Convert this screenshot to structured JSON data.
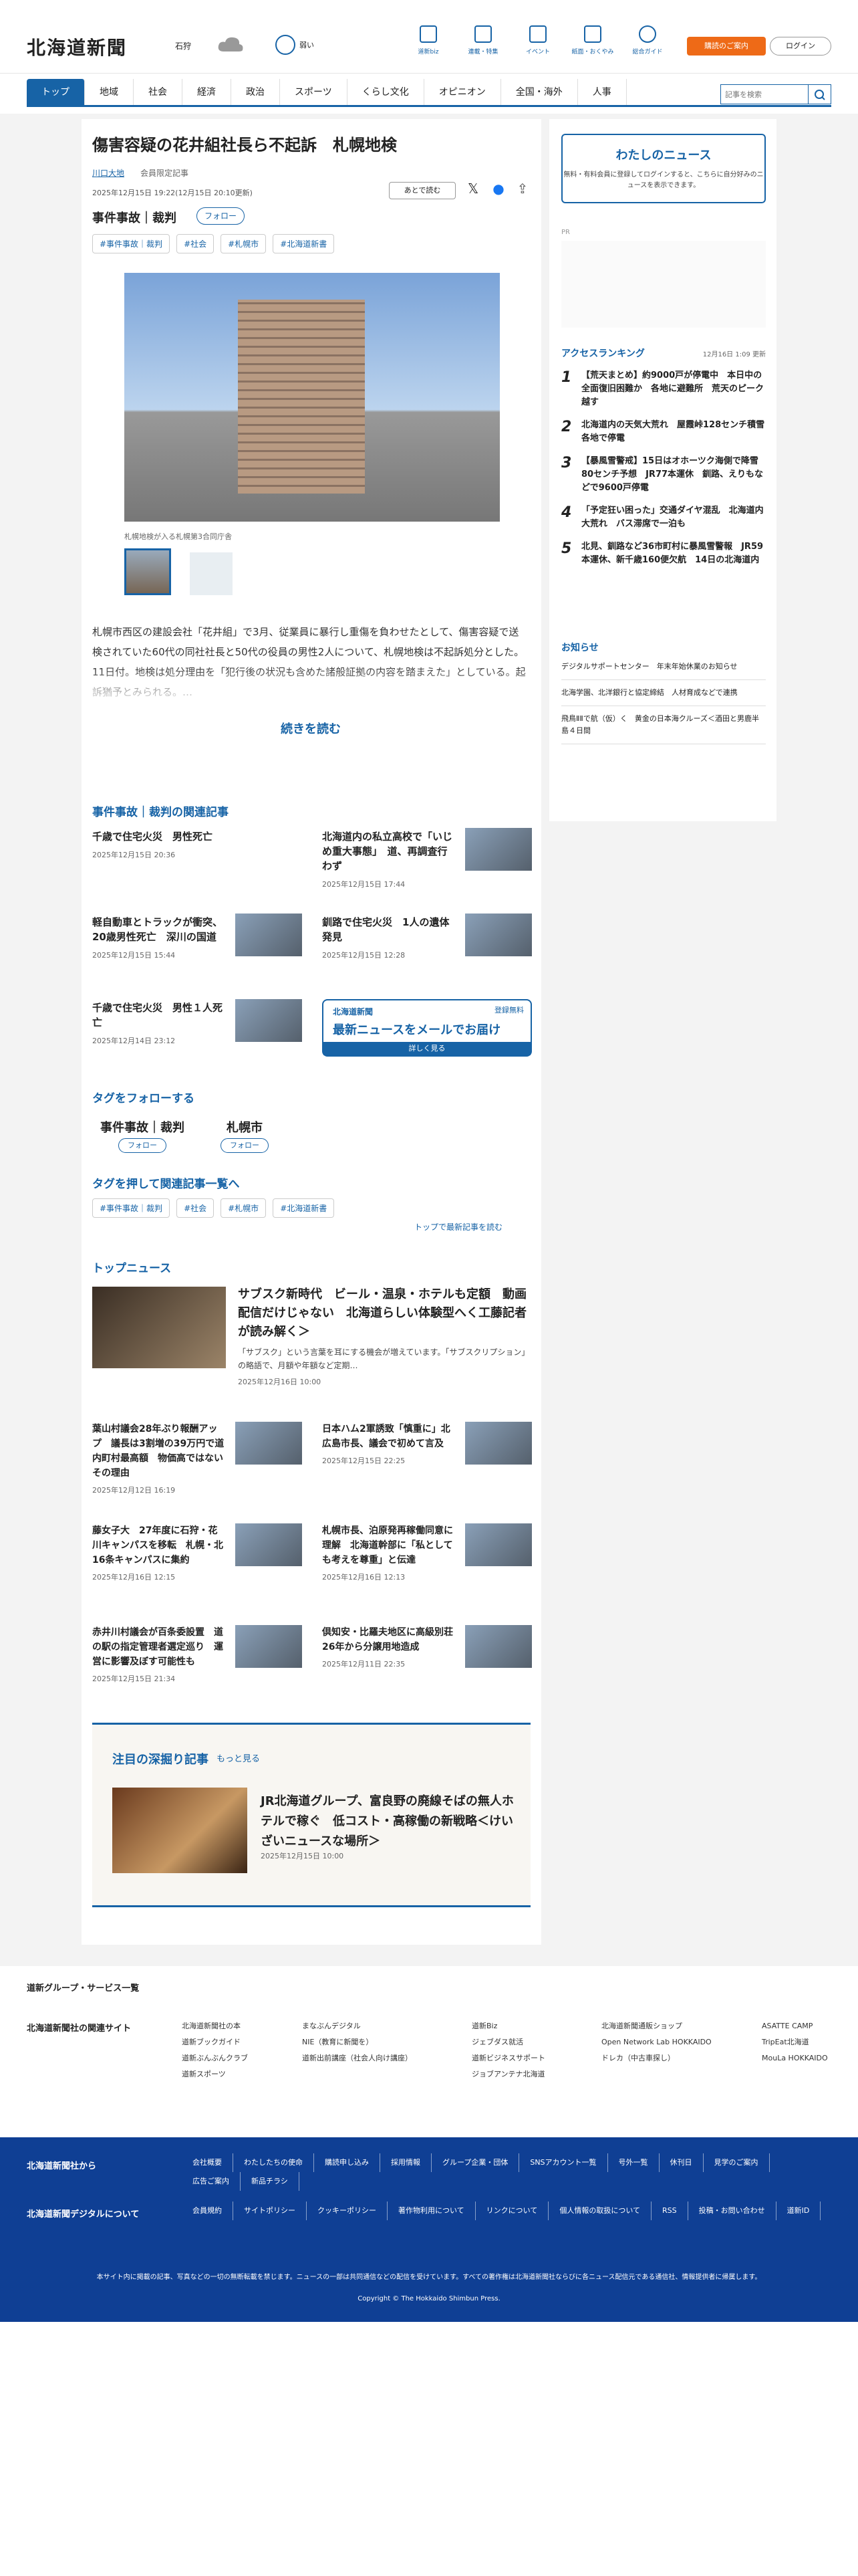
{
  "header": {
    "logo": "北海道新聞",
    "city": "石狩",
    "uv_label": "弱い",
    "nav": [
      "道新biz",
      "連載・特集",
      "イベント",
      "紙面・おくやみ",
      "総合ガイド"
    ],
    "subscribe": "購読のご案内",
    "login": "ログイン"
  },
  "gnav": [
    "トップ",
    "地域",
    "社会",
    "経済",
    "政治",
    "スポーツ",
    "くらし文化",
    "オピニオン",
    "全国・海外",
    "人事"
  ],
  "search_placeholder": "記事を検索",
  "article": {
    "title": "傷害容疑の花井組社長ら不起訴　札幌地検",
    "author": "川口大地",
    "bureau": "会員限定記事",
    "date": "2025年12月15日 19:22(12月15日 20:10更新)",
    "save_later": "あとで読む",
    "category": "事件事故｜裁判",
    "follow": "フォロー",
    "tags": [
      "#事件事故｜裁判",
      "#社会",
      "#札幌市",
      "#北海道新書"
    ],
    "caption": "札幌地検が入る札幌第3合同庁舎",
    "body": "札幌市西区の建設会社「花井組」で3月、従業員に暴行し重傷を負わせたとして、傷害容疑で送検されていた60代の同社社長と50代の役員の男性2人について、札幌地検は不起訴処分とした。11日付。地検は処分理由を「犯行後の状況も含めた諸般証拠の内容を踏まえた」としている。起訴猶予とみられる。…",
    "read_more": "続きを読む"
  },
  "related": {
    "heading": "事件事故｜裁判の関連記事",
    "items": [
      {
        "title": "千歳で住宅火災　男性死亡",
        "date": "2025年12月15日 20:36"
      },
      {
        "title": "北海道内の私立高校で「いじめ重大事態」　道、再調査行わず",
        "date": "2025年12月15日 17:44"
      },
      {
        "title": "軽自動車とトラックが衝突、20歳男性死亡　深川の国道",
        "date": "2025年12月15日 15:44"
      },
      {
        "title": "釧路で住宅火災　1人の遺体発見",
        "date": "2025年12月15日 12:28"
      },
      {
        "title": "千歳で住宅火災　男性１人死亡",
        "date": "2025年12月14日 23:12"
      }
    ]
  },
  "banner": {
    "logo": "北海道新聞",
    "free": "登録無料",
    "title": "最新ニュースをメールでお届け",
    "sub": "詳しく見る"
  },
  "follow_tags": {
    "heading": "タグをフォローする",
    "items": [
      "事件事故｜裁判",
      "札幌市"
    ],
    "button": "フォロー"
  },
  "tag_list": {
    "heading": "タグを押して関連記事一覧へ",
    "items": [
      "#事件事故｜裁判",
      "#社会",
      "#札幌市",
      "#北海道新書"
    ],
    "top_link": "トップで最新記事を読む"
  },
  "top_news": {
    "heading": "トップニュース",
    "lead": {
      "title": "サブスク新時代　ビール・温泉・ホテルも定額　動画配信だけじゃない　北海道らしい体験型へく工藤記者が読み解く＞",
      "excerpt": "「サブスク」という言葉を耳にする機会が増えています。「サブスクリプション」の略語で、月額や年額など定期…",
      "date": "2025年12月16日 10:00"
    },
    "items": [
      {
        "title": "葉山村議会28年ぶり報酬アップ　議長は3割増の39万円で道内町村最高額　物価高ではないその理由",
        "date": "2025年12月12日 16:19"
      },
      {
        "title": "日本ハム2軍誘致「慎重に」北広島市長、議会で初めて言及",
        "date": "2025年12月15日 22:25"
      },
      {
        "title": "藤女子大　27年度に石狩・花川キャンパスを移転　札幌・北16条キャンパスに集約",
        "date": "2025年12月16日 12:15"
      },
      {
        "title": "札幌市長、泊原発再稼働同意に理解　北海道幹部に「私としても考えを尊重」と伝達",
        "date": "2025年12月16日 12:13"
      },
      {
        "title": "赤井川村議会が百条委設置　道の駅の指定管理者選定巡り　運営に影響及ぼす可能性も",
        "date": "2025年12月15日 21:34"
      },
      {
        "title": "倶知安・比羅夫地区に高級別荘　26年から分譲用地造成",
        "date": "2025年12月11日 22:35"
      }
    ]
  },
  "deep": {
    "heading": "注目の深掘り記事",
    "more": "もっと見る",
    "title": "JR北海道グループ、富良野の廃線そばの無人ホテルで稼ぐ　低コスト・高稼働の新戦略＜けいざいニュースな場所＞",
    "date": "2025年12月15日 10:00"
  },
  "sidebar": {
    "mynews_title": "わたしのニュース",
    "mynews_text": "無料・有料会員に登録してログインすると、こちらに自分好みのニュースを表示できます。",
    "pr": "PR",
    "ranking_title": "アクセスランキング",
    "ranking_updated": "12月16日 1:09 更新",
    "ranking": [
      "【荒天まとめ】約9000戸が停電中　本日中の全面復旧困難か　各地に避難所　荒天のピーク越す",
      "北海道内の天気大荒れ　屋霞峠128センチ積雪　各地で停電",
      "【暴風雪警戒】15日はオホーツク海側で降雪80センチ予想　JR77本運休　釧路、えりもなどで9600戸停電",
      "「予定狂い困った」交通ダイヤ混乱　北海道内大荒れ　バス滞席で一泊も",
      "北見、釧路など36市町村に暴風雪警報　JR59本運休、新千歳160便欠航　14日の北海道内"
    ],
    "notice_title": "お知らせ",
    "notices": [
      "デジタルサポートセンター　年末年始休業のお知らせ",
      "北海学園、北洋銀行と協定締結　人材育成などで連携",
      "飛鳥ⅡⅡで航（仮）く　黄金の日本海クルーズ＜酒田と男鹿半島４日間"
    ]
  },
  "footer": {
    "group_link": "道新グループ・サービス一覧",
    "related_label": "北海道新聞社の関連サイト",
    "cols": [
      [
        "北海道新聞社の本",
        "道新ブックガイド",
        "道新ぶんぶんクラブ",
        "道新スポーツ"
      ],
      [
        "まなぶんデジタル",
        "NIE（教育に新聞を）",
        "道新出前講座（社会人向け講座）"
      ],
      [
        "道新Biz",
        "ジェブダス就活",
        "道新ビジネスサポート",
        "ジョブアンテナ北海道"
      ],
      [
        "北海道新聞通販ショップ",
        "Open Network Lab HOKKAIDO",
        "ドレカ（中古車探し）"
      ],
      [
        "ASATTE CAMP",
        "TripEat北海道",
        "MouLa HOKKAIDO"
      ]
    ],
    "company_label": "北海道新聞社から",
    "company_links": [
      "会社概要",
      "わたしたちの使命",
      "購読申し込み",
      "採用情報",
      "グループ企業・団体",
      "SNSアカウント一覧",
      "号外一覧",
      "休刊日",
      "見学のご案内",
      "広告ご案内",
      "新品チラシ"
    ],
    "digital_label": "北海道新聞デジタルについて",
    "digital_links": [
      "会員規約",
      "サイトポリシー",
      "クッキーポリシー",
      "著作物利用について",
      "リンクについて",
      "個人情報の取扱について",
      "RSS",
      "投稿・お問い合わせ",
      "道新ID"
    ],
    "notice": "本サイト内に掲載の記事、写真などの一切の無断転載を禁じます。ニュースの一部は共同通信などの配信を受けています。すべての著作権は北海道新聞社ならびに各ニュース配信元である通信社、情報提供者に帰属します。",
    "copyright": "Copyright © The Hokkaido Shimbun Press."
  }
}
